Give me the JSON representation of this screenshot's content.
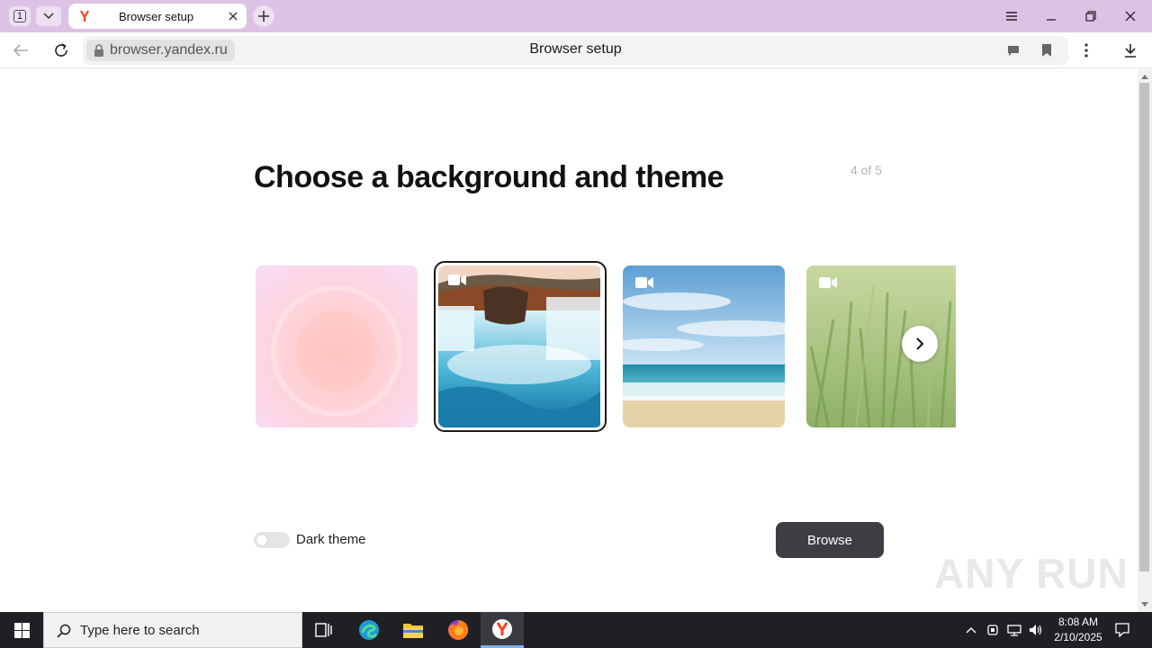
{
  "window": {
    "tab_count": "1",
    "tab_title": "Browser setup"
  },
  "address_bar": {
    "url": "browser.yandex.ru",
    "page_title": "Browser setup"
  },
  "page": {
    "heading": "Choose a background and theme",
    "step": "4 of 5",
    "backgrounds": [
      {
        "name": "Pastel gradient",
        "video": false,
        "selected": false
      },
      {
        "name": "Waterfall",
        "video": true,
        "selected": true
      },
      {
        "name": "Beach",
        "video": true,
        "selected": false
      },
      {
        "name": "Grass",
        "video": true,
        "selected": false
      }
    ],
    "dark_theme_label": "Dark theme",
    "dark_theme_on": false,
    "browse_label": "Browse"
  },
  "watermark": "ANY RUN",
  "taskbar": {
    "search_placeholder": "Type here to search",
    "time": "8:08 AM",
    "date": "2/10/2025"
  },
  "colors": {
    "titlebar": "#dcc2e4",
    "browse_button": "#3d3d43",
    "taskbar": "#1f2024",
    "yandex_red": "#fc3f1d"
  }
}
